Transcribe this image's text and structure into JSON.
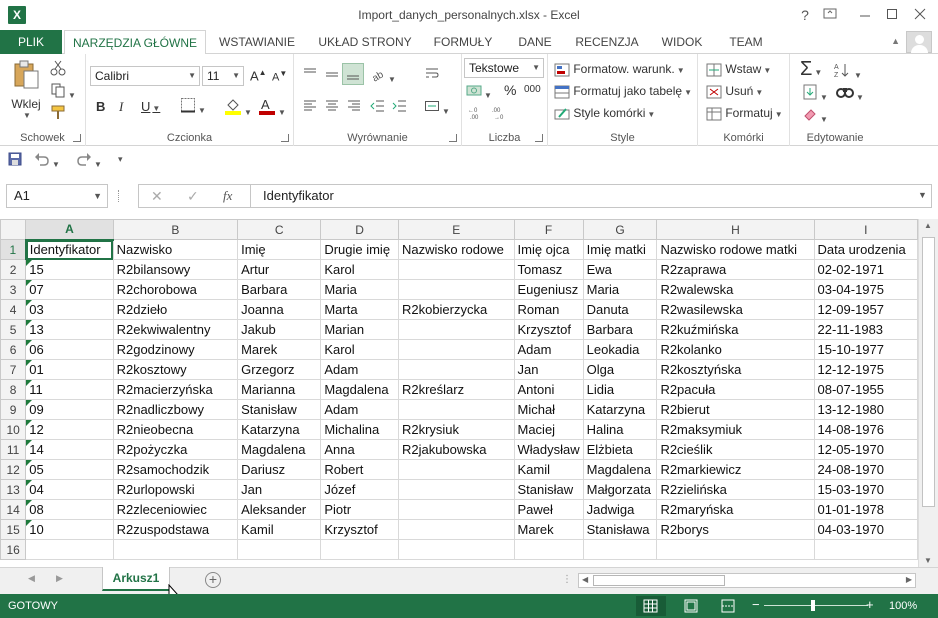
{
  "window": {
    "title": "Import_danych_personalnych.xlsx - Excel",
    "help": "?"
  },
  "tabs": [
    "PLIK",
    "NARZĘDZIA GŁÓWNE",
    "WSTAWIANIE",
    "UKŁAD STRONY",
    "FORMUŁY",
    "DANE",
    "RECENZJA",
    "WIDOK",
    "TEAM"
  ],
  "ribbon": {
    "clipboard": {
      "paste": "Wklej",
      "label": "Schowek"
    },
    "font": {
      "name": "Calibri",
      "size": "11",
      "bold": "B",
      "italic": "I",
      "underline": "U",
      "grow": "A",
      "shrink": "A",
      "label": "Czcionka"
    },
    "align": {
      "label": "Wyrównanie"
    },
    "number": {
      "format": "Tekstowe",
      "percent": "%",
      "thousands": "000",
      "label": "Liczba"
    },
    "style": {
      "conditional": "Formatow. warunk.",
      "table": "Formatuj jako tabelę",
      "cell": "Style komórki",
      "label": "Style"
    },
    "cells": {
      "insert": "Wstaw",
      "delete": "Usuń",
      "format": "Formatuj",
      "label": "Komórki"
    },
    "edit": {
      "label": "Edytowanie"
    }
  },
  "formula_bar": {
    "name_box": "A1",
    "fx": "fx",
    "content": "Identyfikator"
  },
  "columns": [
    "A",
    "B",
    "C",
    "D",
    "E",
    "F",
    "G",
    "H",
    "I"
  ],
  "headers": [
    "Identyfikator",
    "Nazwisko",
    "Imię",
    "Drugie imię",
    "Nazwisko rodowe",
    "Imię ojca",
    "Imię matki",
    "Nazwisko rodowe matki",
    "Data urodzenia"
  ],
  "rows": [
    [
      "15",
      "R2bilansowy",
      "Artur",
      "Karol",
      "",
      "Tomasz",
      "Ewa",
      "R2zaprawa",
      "02-02-1971"
    ],
    [
      "07",
      "R2chorobowa",
      "Barbara",
      "Maria",
      "",
      "Eugeniusz",
      "Maria",
      "R2walewska",
      "03-04-1975"
    ],
    [
      "03",
      "R2dzieło",
      "Joanna",
      "Marta",
      "R2kobierzycka",
      "Roman",
      "Danuta",
      "R2wasilewska",
      "12-09-1957"
    ],
    [
      "13",
      "R2ekwiwalentny",
      "Jakub",
      "Marian",
      "",
      "Krzysztof",
      "Barbara",
      "R2kuźmińska",
      "22-11-1983"
    ],
    [
      "06",
      "R2godzinowy",
      "Marek",
      "Karol",
      "",
      "Adam",
      "Leokadia",
      "R2kolanko",
      "15-10-1977"
    ],
    [
      "01",
      "R2kosztowy",
      "Grzegorz",
      "Adam",
      "",
      "Jan",
      "Olga",
      "R2kosztyńska",
      "12-12-1975"
    ],
    [
      "11",
      "R2macierzyńska",
      "Marianna",
      "Magdalena",
      "R2kreślarz",
      "Antoni",
      "Lidia",
      "R2pacuła",
      "08-07-1955"
    ],
    [
      "09",
      "R2nadliczbowy",
      "Stanisław",
      "Adam",
      "",
      "Michał",
      "Katarzyna",
      "R2bierut",
      "13-12-1980"
    ],
    [
      "12",
      "R2nieobecna",
      "Katarzyna",
      "Michalina",
      "R2krysiuk",
      "Maciej",
      "Halina",
      "R2maksymiuk",
      "14-08-1976"
    ],
    [
      "14",
      "R2pożyczka",
      "Magdalena",
      "Anna",
      "R2jakubowska",
      "Władysław",
      "Elżbieta",
      "R2cieślik",
      "12-05-1970"
    ],
    [
      "05",
      "R2samochodzik",
      "Dariusz",
      "Robert",
      "",
      "Kamil",
      "Magdalena",
      "R2markiewicz",
      "24-08-1970"
    ],
    [
      "04",
      "R2urlopowski",
      "Jan",
      "Józef",
      "",
      "Stanisław",
      "Małgorzata",
      "R2zielińska",
      "15-03-1970"
    ],
    [
      "08",
      "R2zleceniowiec",
      "Aleksander",
      "Piotr",
      "",
      "Paweł",
      "Jadwiga",
      "R2maryńska",
      "01-01-1978"
    ],
    [
      "10",
      "R2zuspodstawa",
      "Kamil",
      "Krzysztof",
      "",
      "Marek",
      "Stanisława",
      "R2borys",
      "04-03-1970"
    ],
    [
      "",
      "",
      "",
      "",
      "",
      "",
      "",
      "",
      ""
    ]
  ],
  "row_numbers": [
    "1",
    "2",
    "3",
    "4",
    "5",
    "6",
    "7",
    "8",
    "9",
    "10",
    "11",
    "12",
    "13",
    "14",
    "15",
    "16"
  ],
  "sheet_tab": "Arkusz1",
  "status": {
    "text": "GOTOWY",
    "zoom": "100%"
  },
  "colors": {
    "accent": "#217346"
  }
}
